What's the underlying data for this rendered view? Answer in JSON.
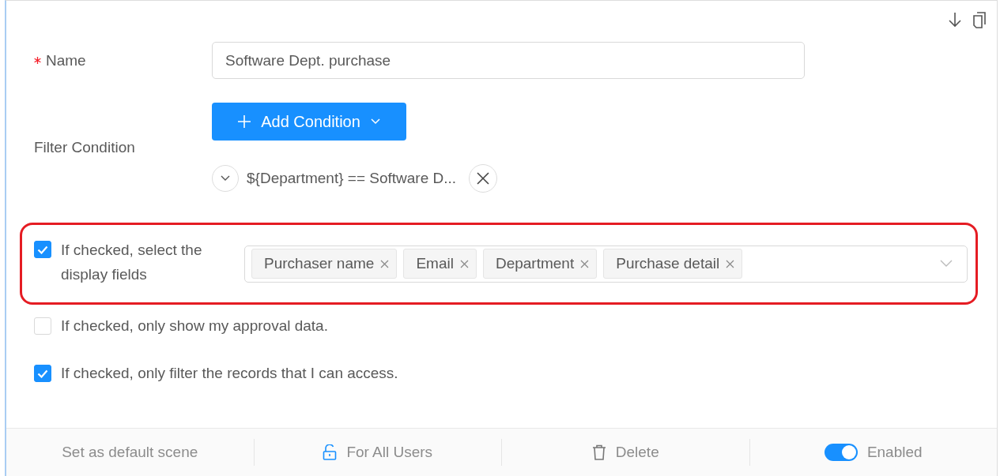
{
  "name_field": {
    "label": "Name",
    "required": true,
    "value": "Software Dept. purchase"
  },
  "filter": {
    "label": "Filter Condition",
    "add_button": "Add Condition",
    "conditions": [
      {
        "text": "${Department} == Software D...",
        "expanded": false
      }
    ]
  },
  "display_fields": {
    "checked": true,
    "label": "If checked, select the display fields",
    "highlighted": true,
    "tags": [
      "Purchaser name",
      "Email",
      "Department",
      "Purchase detail"
    ]
  },
  "options": [
    {
      "label": "If checked, only show my approval data.",
      "checked": false
    },
    {
      "label": "If checked, only filter the records that I can access.",
      "checked": true
    }
  ],
  "footer": {
    "default_scene": "Set as default scene",
    "for_all_users": "For All Users",
    "delete": "Delete",
    "enabled_label": "Enabled",
    "enabled": true
  }
}
